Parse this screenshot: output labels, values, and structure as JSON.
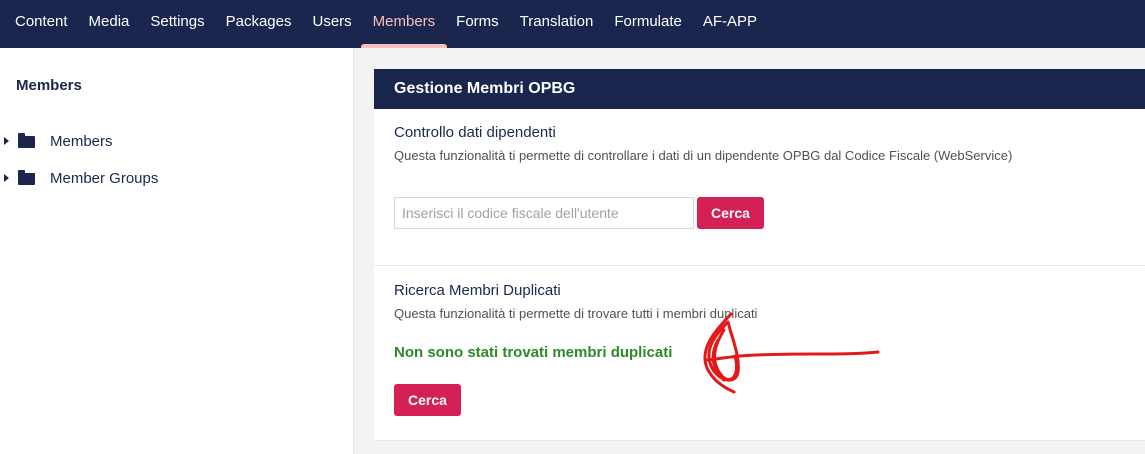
{
  "topnav": {
    "items": [
      {
        "label": "Content"
      },
      {
        "label": "Media"
      },
      {
        "label": "Settings"
      },
      {
        "label": "Packages"
      },
      {
        "label": "Users"
      },
      {
        "label": "Members",
        "active": true
      },
      {
        "label": "Forms"
      },
      {
        "label": "Translation"
      },
      {
        "label": "Formulate"
      },
      {
        "label": "AF-APP"
      }
    ]
  },
  "sidebar": {
    "title": "Members",
    "items": [
      {
        "label": "Members",
        "icon": "folder-icon"
      },
      {
        "label": "Member Groups",
        "icon": "folder-icon"
      }
    ]
  },
  "panel": {
    "header": "Gestione Membri OPBG",
    "section1": {
      "title": "Controllo dati dipendenti",
      "description": "Questa funzionalità ti permette di controllare i dati di un dipendente OPBG dal Codice Fiscale (WebService)",
      "input_placeholder": "Inserisci il codice fiscale dell'utente",
      "input_value": "",
      "button_label": "Cerca"
    },
    "section2": {
      "title": "Ricerca Membri Duplicati",
      "description": "Questa funzionalità ti permette di trovare tutti i membri duplicati",
      "result_message": "Non sono stati trovati membri duplicati",
      "button_label": "Cerca"
    }
  },
  "colors": {
    "nav_bg": "#1b264f",
    "active_tab": "#f5c1bc",
    "button": "#d42054",
    "success": "#2b8a2b",
    "annotation": "#e31818"
  }
}
